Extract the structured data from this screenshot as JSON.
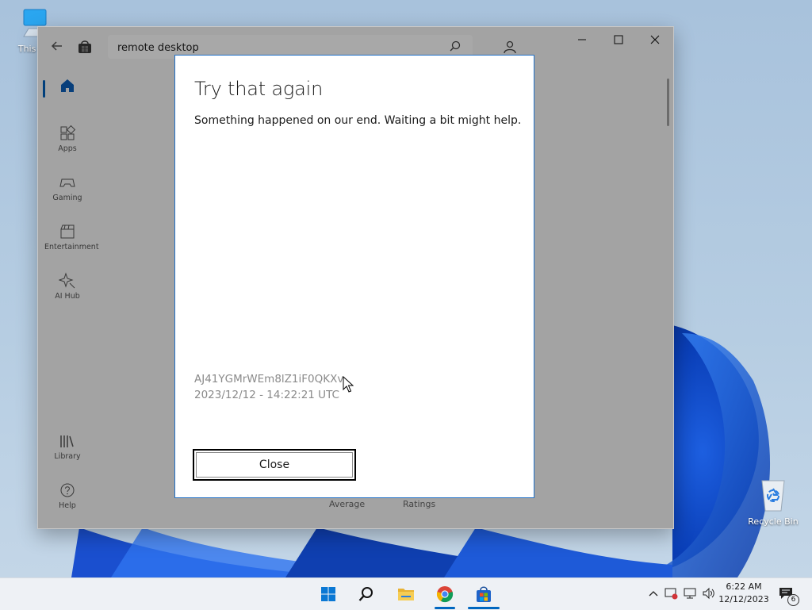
{
  "desktop": {
    "icons": [
      {
        "label": "This PC"
      },
      {
        "label": "Recycle Bin"
      }
    ]
  },
  "store": {
    "search": {
      "value": "remote desktop"
    },
    "nav": [
      {
        "label": ""
      },
      {
        "label": "Apps"
      },
      {
        "label": "Gaming"
      },
      {
        "label": "Entertainment"
      },
      {
        "label": "AI Hub"
      },
      {
        "label": "Library"
      },
      {
        "label": "Help"
      }
    ],
    "ratings": {
      "average_label": "Average",
      "ratings_label": "Ratings"
    }
  },
  "dialog": {
    "title": "Try that again",
    "message": "Something happened on our end. Waiting a bit might help.",
    "code": "AJ41YGMrWEm8lZ1iF0QKXv",
    "timestamp": "2023/12/12 - 14:22:21 UTC",
    "close_label": "Close"
  },
  "taskbar": {
    "time": "6:22 AM",
    "date": "12/12/2023",
    "notification_count": "6",
    "accent": "#0067c0"
  }
}
